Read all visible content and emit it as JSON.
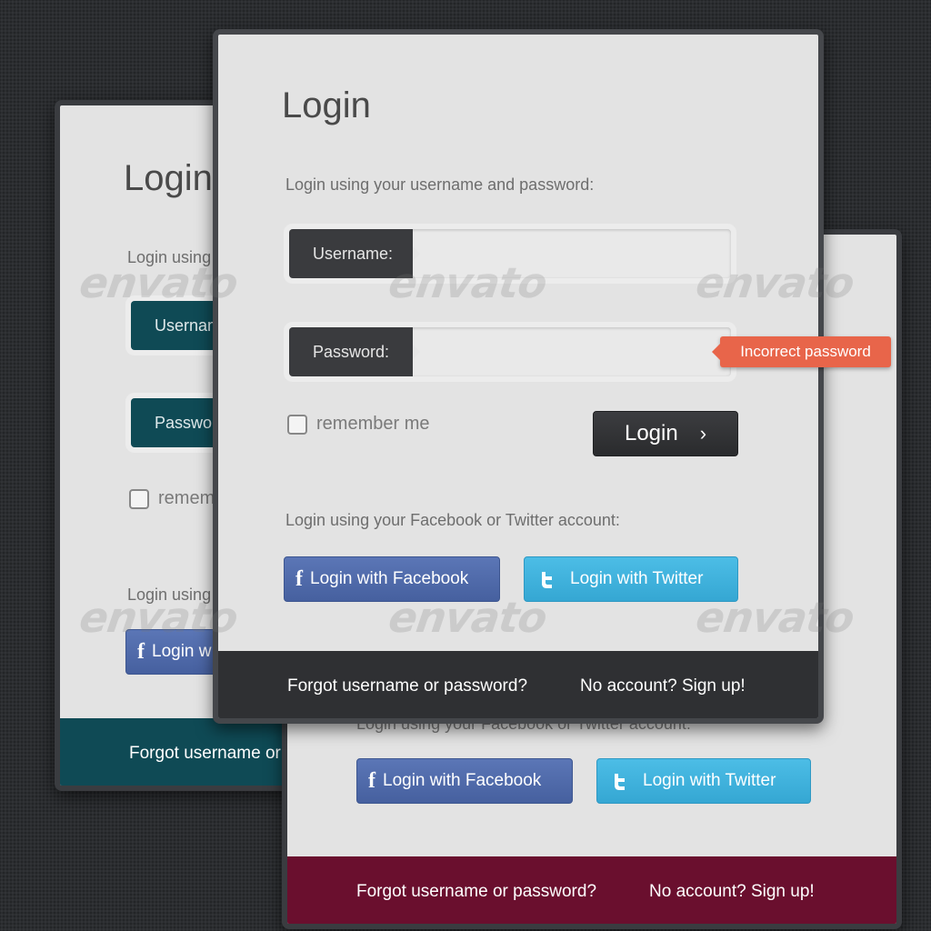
{
  "colors": {
    "page_bg": "#2b2d30",
    "card_bg": "#e3e3e3",
    "teal": "#0f4a55",
    "maroon": "#6a0f2e",
    "dark": "#2f3033",
    "error_badge": "#e8654a",
    "facebook": "#4e69a8",
    "twitter": "#3ab0dc"
  },
  "front_card": {
    "title": "Login",
    "subtitle": "Login using your username and password:",
    "username_label": "Username:",
    "username_value": "",
    "password_label": "Password:",
    "password_value": "",
    "error_badge": "Incorrect password",
    "remember_label": "remember me",
    "remember_checked": false,
    "login_button": "Login",
    "social_hint": "Login using your Facebook or Twitter account:",
    "facebook_button": "Login with Facebook",
    "twitter_button": "Login with Twitter",
    "forgot_link": "Forgot username or password?",
    "signup_link": "No account? Sign up!"
  },
  "back_left_card": {
    "title": "Login",
    "subtitle": "Login using",
    "username_label": "Usernam",
    "password_label": "Passwo",
    "remember_label": "rememb",
    "social_hint": "Login using",
    "facebook_button": "Login w",
    "forgot_link": "Forgot username or"
  },
  "back_right_card": {
    "social_hint": "Login using your Facebook or Twitter account:",
    "facebook_button": "Login with Facebook",
    "twitter_button": "Login with Twitter",
    "forgot_link": "Forgot username or password?",
    "signup_link": "No account? Sign up!"
  },
  "watermark": "envato"
}
